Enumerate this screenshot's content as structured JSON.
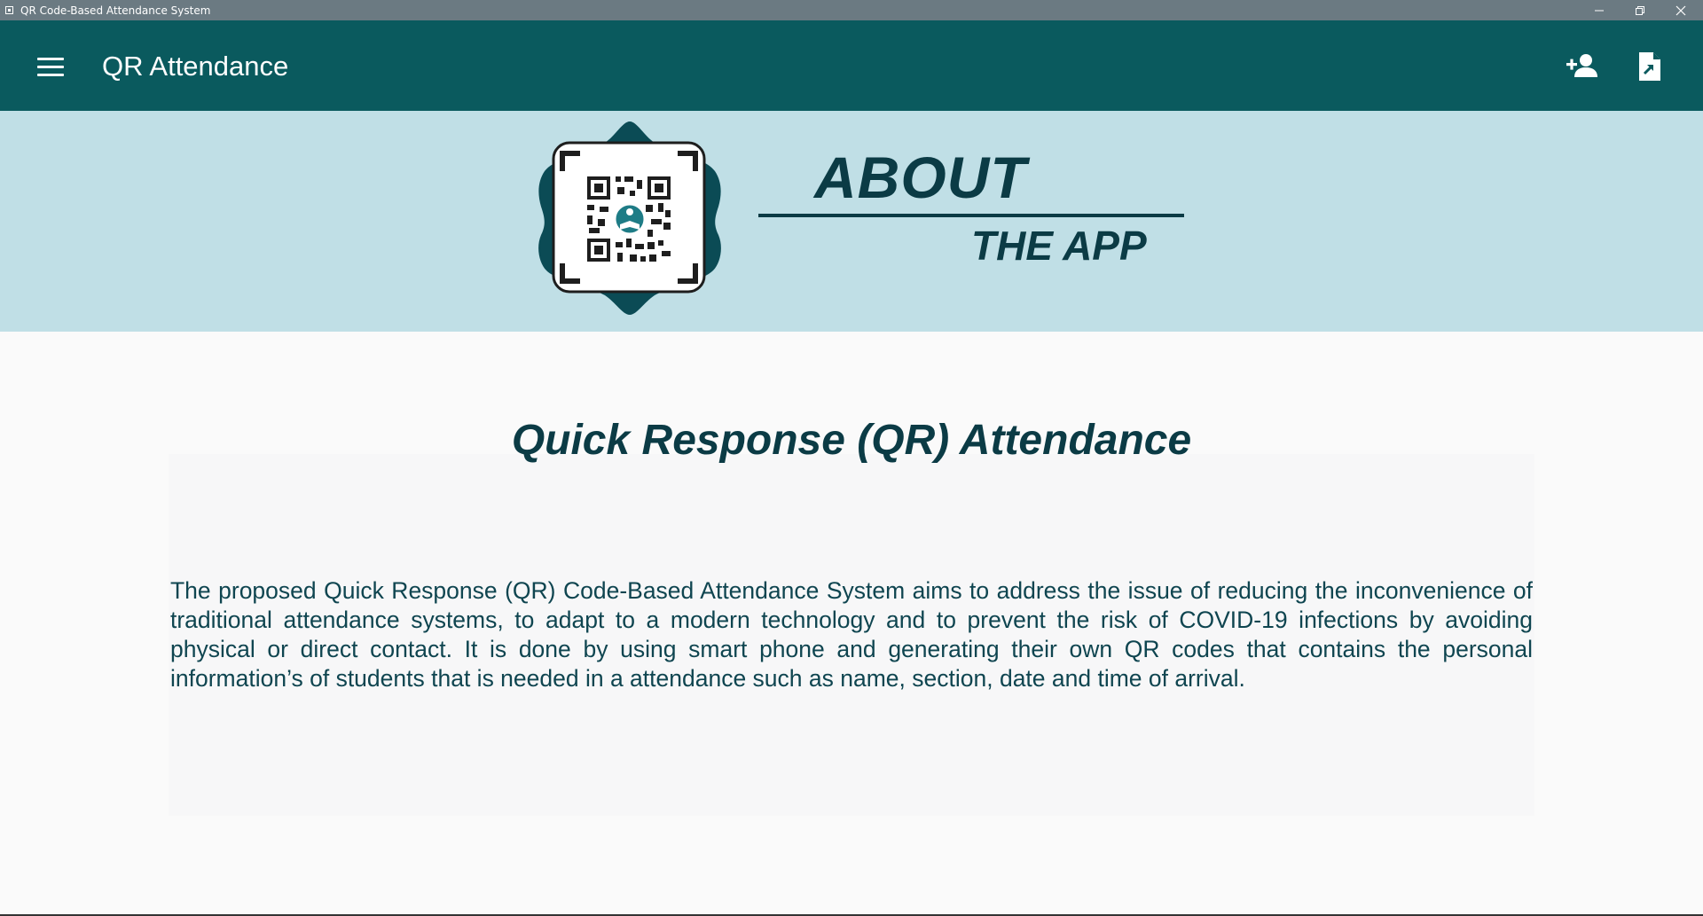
{
  "window": {
    "title": "QR Code-Based Attendance System"
  },
  "appbar": {
    "title": "QR Attendance",
    "menu_icon": "menu-icon",
    "actions": [
      {
        "icon": "person-add-icon"
      },
      {
        "icon": "file-export-icon"
      }
    ],
    "background": "#0a5a5e"
  },
  "banner": {
    "about": "ABOUT",
    "the_app": "THE APP",
    "logo_icon": "qr-code-logo-icon",
    "background": "#c0dfe6"
  },
  "content": {
    "heading": "Quick Response (QR) Attendance",
    "description": "The proposed Quick Response (QR) Code-Based Attendance System aims to address the issue of reducing the inconvenience of traditional attendance systems, to adapt to a modern technology and to prevent the risk of COVID-19 infections by avoiding physical or direct contact. It is done by using smart phone and generating their own QR codes that contains the personal information’s of students that is needed in a attendance such as name, section, date and time of arrival."
  },
  "colors": {
    "accent": "#0b3b45",
    "titlebar": "#6b7a82"
  }
}
